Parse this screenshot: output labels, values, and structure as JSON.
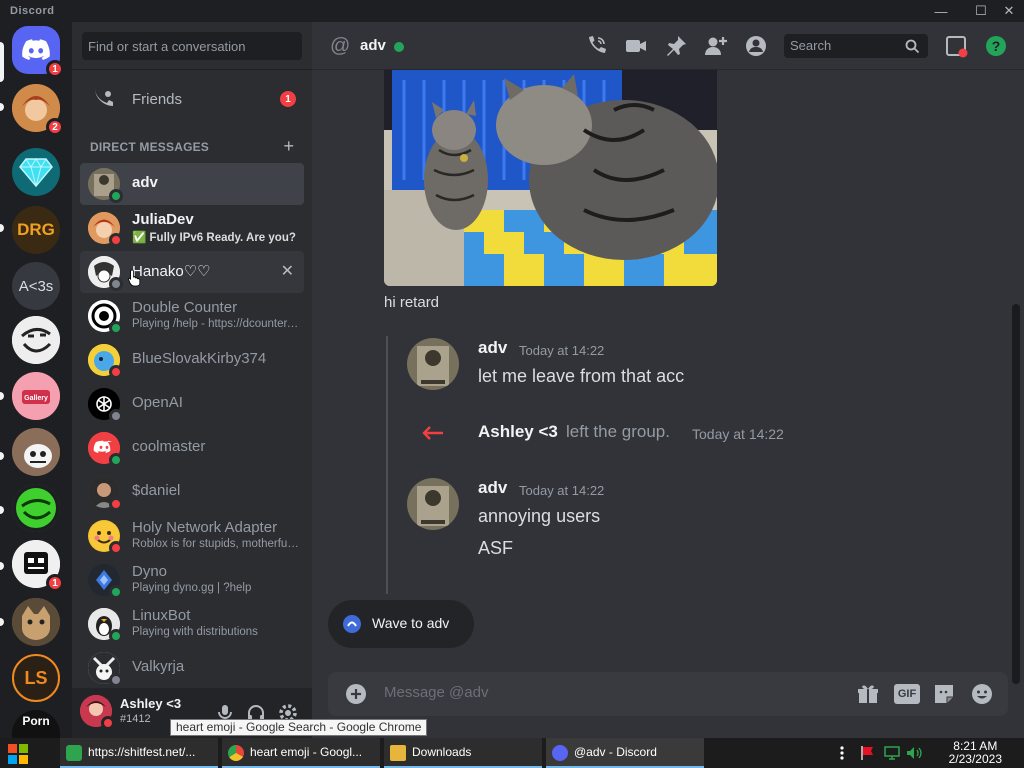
{
  "app": {
    "title": "Discord"
  },
  "window_controls": {
    "minimize": "—",
    "maximize": "☐",
    "close": "✕"
  },
  "servers": [
    {
      "name": "Home",
      "badge": "1",
      "color": "#5865f2"
    },
    {
      "name": "Art server",
      "badge": "2",
      "color": "#c0763a"
    },
    {
      "name": "Diamond",
      "badge": "",
      "color": "#1fa2b8"
    },
    {
      "name": "DRG",
      "label": "DRG",
      "badge": "",
      "color": "#3a2a14"
    },
    {
      "name": "A<3s",
      "label": "A<3s",
      "badge": "",
      "color": "#36393f"
    },
    {
      "name": "Troll",
      "badge": "",
      "color": "#e8e8e8"
    },
    {
      "name": "Gallery",
      "badge": "",
      "color": "#d94d62"
    },
    {
      "name": "Sans",
      "badge": "",
      "color": "#6e5648"
    },
    {
      "name": "Green troll",
      "badge": "",
      "color": "#2b8a1e"
    },
    {
      "name": "Robot",
      "badge": "1",
      "color": "#e8e8e8"
    },
    {
      "name": "Cat",
      "badge": "",
      "color": "#8b7155"
    },
    {
      "name": "LS",
      "label": "LS",
      "badge": "",
      "color": "#2a2015"
    },
    {
      "name": "Porn hub",
      "label": "Porn",
      "badge": "",
      "color": "#111"
    }
  ],
  "dm_column": {
    "search_placeholder": "Find or start a conversation",
    "friends_label": "Friends",
    "friends_badge": "1",
    "direct_messages_header": "DIRECT MESSAGES",
    "add_dm": "+",
    "items": [
      {
        "name": "adv",
        "sub": "",
        "status": "on"
      },
      {
        "name": "JuliaDev",
        "sub": "✅ Fully IPv6 Ready. Are you?",
        "status": "dnd"
      },
      {
        "name": "Hanako♡♡",
        "sub": "",
        "status": "off"
      },
      {
        "name": "Double Counter",
        "sub": "Playing /help - https://dcounter.space",
        "status": "on"
      },
      {
        "name": "BlueSlovakKirby374",
        "sub": "",
        "status": "dnd"
      },
      {
        "name": "OpenAI",
        "sub": "",
        "status": "off"
      },
      {
        "name": "coolmaster",
        "sub": "",
        "status": "on"
      },
      {
        "name": "$daniel",
        "sub": "",
        "status": "dnd"
      },
      {
        "name": "Holy Network Adapter",
        "sub": "Roblox is for stupids, motherfuckers",
        "status": "dnd"
      },
      {
        "name": "Dyno",
        "sub": "Playing dyno.gg | ?help",
        "status": "on"
      },
      {
        "name": "LinuxBot",
        "sub": "Playing with distributions",
        "status": "on"
      },
      {
        "name": "Valkyrja",
        "sub": "",
        "status": "off"
      }
    ],
    "close_dm": "✕"
  },
  "user_panel": {
    "name": "Ashley <3",
    "tag": "#1412"
  },
  "tooltip": "heart emoji - Google Search - Google Chrome",
  "channel": {
    "name": "adv",
    "at": "@"
  },
  "header": {
    "search_placeholder": "Search",
    "help": "?"
  },
  "messages": {
    "caption": "hi retard",
    "msg1": {
      "author": "adv",
      "time": "Today at 14:22",
      "lines": [
        "let me leave from that acc"
      ]
    },
    "system": {
      "author": "Ashley <3",
      "text": "left the group.",
      "time": "Today at 14:22"
    },
    "msg2": {
      "author": "adv",
      "time": "Today at 14:22",
      "lines": [
        "annoying users",
        "ASF"
      ]
    }
  },
  "wave": {
    "label": "Wave to adv"
  },
  "composer": {
    "placeholder": "Message @adv",
    "gif": "GIF"
  },
  "taskbar": {
    "items": [
      {
        "label": "https://shitfest.net/...",
        "color": "#2ea44f"
      },
      {
        "label": "heart emoji - Googl...",
        "color": "#e8453c"
      },
      {
        "label": "Downloads",
        "color": "#e8b53c"
      },
      {
        "label": "@adv - Discord",
        "color": "#5865f2"
      }
    ],
    "time": "8:21 AM",
    "date": "2/23/2023"
  }
}
